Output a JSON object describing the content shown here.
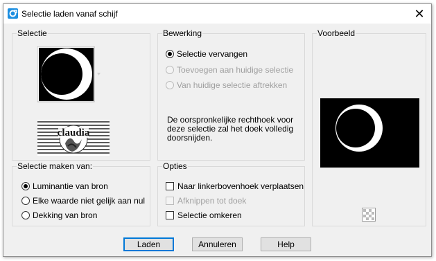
{
  "window": {
    "title": "Selectie laden vanaf schijf"
  },
  "selectie": {
    "label": "Selectie",
    "thumbnail_caption": "claudia"
  },
  "bewerking": {
    "label": "Bewerking",
    "options": [
      {
        "label": "Selectie vervangen",
        "checked": true,
        "enabled": true
      },
      {
        "label": "Toevoegen aan huidige selectie",
        "checked": false,
        "enabled": false
      },
      {
        "label": "Van huidige selectie aftrekken",
        "checked": false,
        "enabled": false
      }
    ],
    "description": "De oorspronkelijke rechthoek voor deze selectie zal het doek volledig doorsnijden."
  },
  "voorbeeld": {
    "label": "Voorbeeld"
  },
  "maken_van": {
    "label": "Selectie maken van:",
    "options": [
      {
        "label": "Luminantie van bron",
        "checked": true
      },
      {
        "label": "Elke waarde niet gelijk aan nul",
        "checked": false
      },
      {
        "label": "Dekking van bron",
        "checked": false
      }
    ]
  },
  "opties": {
    "label": "Opties",
    "items": [
      {
        "label": "Naar linkerbovenhoek verplaatsen",
        "checked": false,
        "enabled": true
      },
      {
        "label": "Afknippen tot doek",
        "checked": false,
        "enabled": false
      },
      {
        "label": "Selectie omkeren",
        "checked": false,
        "enabled": true
      }
    ]
  },
  "buttons": {
    "load": "Laden",
    "cancel": "Annuleren",
    "help": "Help"
  },
  "colors": {
    "default_button_border": "#0078d7",
    "app_icon": "#1e90ff"
  }
}
